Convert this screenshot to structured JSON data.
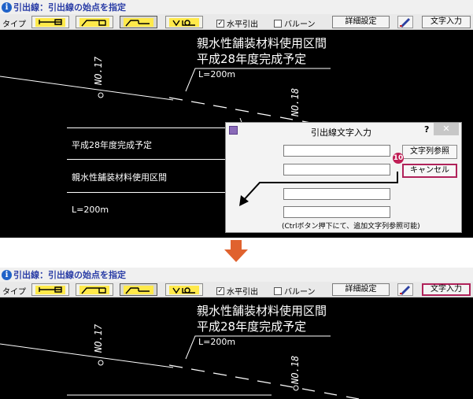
{
  "header": {
    "title": "引出線：引出線の始点を指定",
    "info_icon": "i"
  },
  "toolbar": {
    "type_label": "タイプ",
    "type_icons": [
      "leader-left-icon",
      "leader-step-icon",
      "leader-diagonal-icon",
      "leader-balloon-icon"
    ],
    "pressed_type_index": 2,
    "horizontal_checkbox": {
      "label": "水平引出",
      "checked": true,
      "mark": "✓"
    },
    "balloon_checkbox": {
      "label": "バルーン",
      "checked": false
    },
    "detail_button": "詳細設定",
    "text_input_button": "文字入力"
  },
  "drawing": {
    "label_line1": "親水性舗装材料使用区間",
    "label_line2": "平成28年度完成予定",
    "label_length": "L=200m",
    "station_no17": "NO.17",
    "station_no18": "NO.18",
    "table_rows": [
      "平成28年度完成予定",
      "親水性舗装材料使用区間",
      "L=200m"
    ]
  },
  "dialog": {
    "title": "引出線文字入力",
    "help": "?",
    "close": "✕",
    "ref_button": "文字列参照",
    "cancel_button": "キャンセル",
    "note": "(Ctrlボタン押下にて、追加文字列参照可能)",
    "inputs": [
      "",
      "",
      "",
      ""
    ]
  },
  "step_badge": "10",
  "colors": {
    "canvas": "#000000",
    "highlight": "#b0225a",
    "arrow": "#e0622e",
    "title_text": "#2a3da6"
  }
}
